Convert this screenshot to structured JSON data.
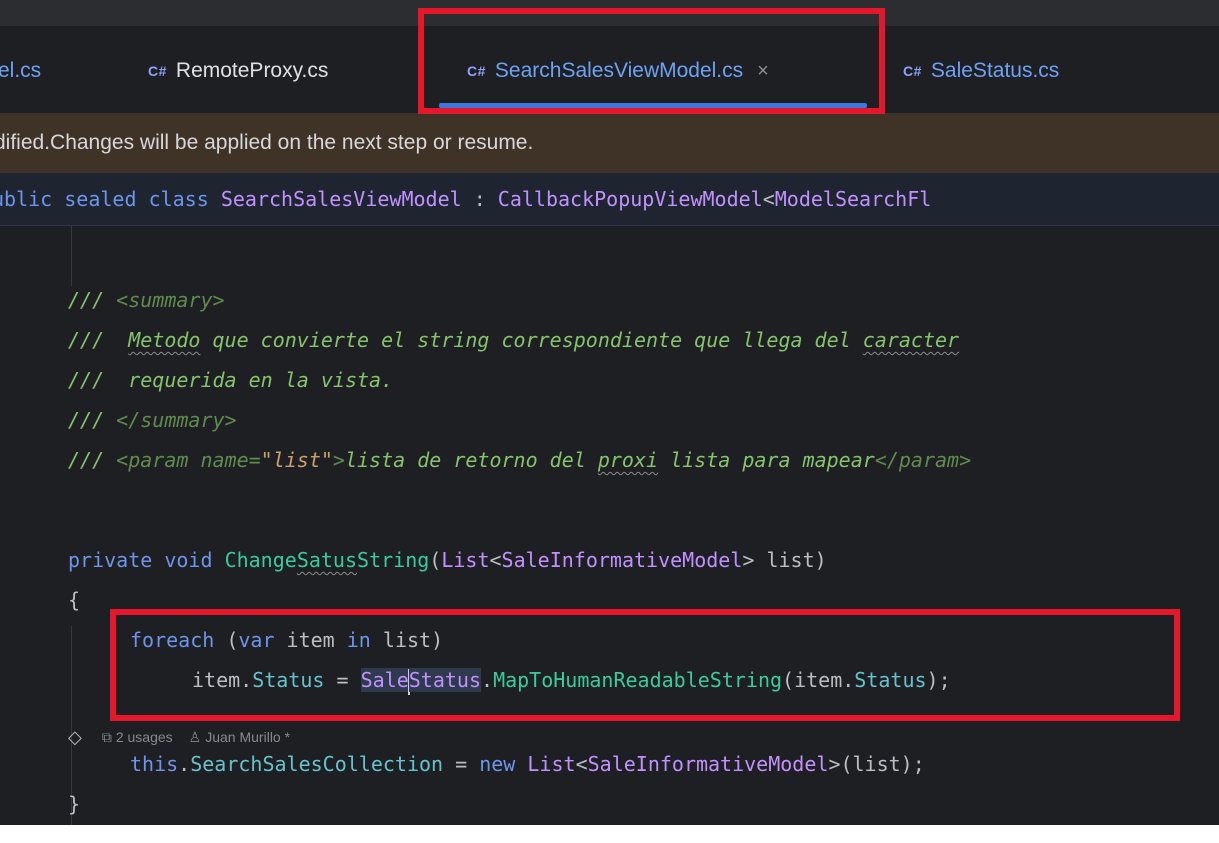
{
  "tabs": [
    {
      "label": "el.cs",
      "lang": "",
      "active": false
    },
    {
      "label": "RemoteProxy.cs",
      "lang": "C#",
      "active": false
    },
    {
      "label": "SearchSalesViewModel.cs",
      "lang": "C#",
      "active": true,
      "close": "×"
    },
    {
      "label": "SaleStatus.cs",
      "lang": "C#",
      "active": false
    }
  ],
  "notification": {
    "text": "dified.Changes will be applied on the next step or resume."
  },
  "sticky": {
    "kw1": "ublic",
    "kw2": "sealed",
    "kw3": "class",
    "name": "SearchSalesViewModel",
    "sep": ":",
    "base": "CallbackPopupViewModel",
    "lt": "<",
    "generic": "ModelSearchFl"
  },
  "code": {
    "c1_slash": "///",
    "c1_tag": "<summary>",
    "c2_slash": "///",
    "c2_word": "Metodo",
    "c2_text": " que convierte el string correspondiente que llega del ",
    "c2_word2": "caracter",
    "c3_slash": "///",
    "c3_text": "requerida en la vista.",
    "c4_slash": "///",
    "c4_tag": "</summary>",
    "c5_slash": "///",
    "c5_open": "<param name=",
    "c5_attr": "\"list\"",
    "c5_close": ">",
    "c5_text1": "lista de retorno del ",
    "c5_word": "proxi",
    "c5_text2": " lista para mapear",
    "c5_end": "</param>",
    "m_private": "private",
    "m_void": "void",
    "m_name1": "Change",
    "m_name2": "Satus",
    "m_name3": "String",
    "m_paren": "(",
    "m_list": "List",
    "m_lt": "<",
    "m_type": "SaleInformativeModel",
    "m_gt": ">",
    "m_param": " list)",
    "brace_open": "{",
    "f_kw": "foreach",
    "f_paren": " (",
    "f_var": "var",
    "f_item": " item ",
    "f_in": "in",
    "f_list": " list)",
    "s_item": "item.",
    "s_status": "Status",
    "s_eq": " = ",
    "s_cls1": "Sale",
    "s_cls2": "Status",
    "s_dot": ".",
    "s_fn": "MapToHumanReadableString",
    "s_arg": "(item.",
    "s_arg_status": "Status",
    "s_end": ");",
    "t_this": "this",
    "t_dot": ".",
    "t_prop": "SearchSalesCollection",
    "t_eq": " = ",
    "t_new": "new",
    "t_list": " List",
    "t_lt": "<",
    "t_type": "SaleInformativeModel",
    "t_end": ">(list);",
    "brace_close": "}"
  },
  "hints": {
    "gem_icon": "◇",
    "usages_icon": "⧉",
    "usages": "2 usages",
    "user_icon": "♙",
    "author": "Juan Murillo *"
  },
  "colors": {
    "background": "#1e1f22",
    "keyword": "#6c95eb",
    "type": "#c191ff",
    "method": "#39cc9b",
    "comment": "#85c46c",
    "annotation_box": "#e4182a",
    "notification_bg": "#3f3327",
    "accent": "#3d77e0"
  }
}
